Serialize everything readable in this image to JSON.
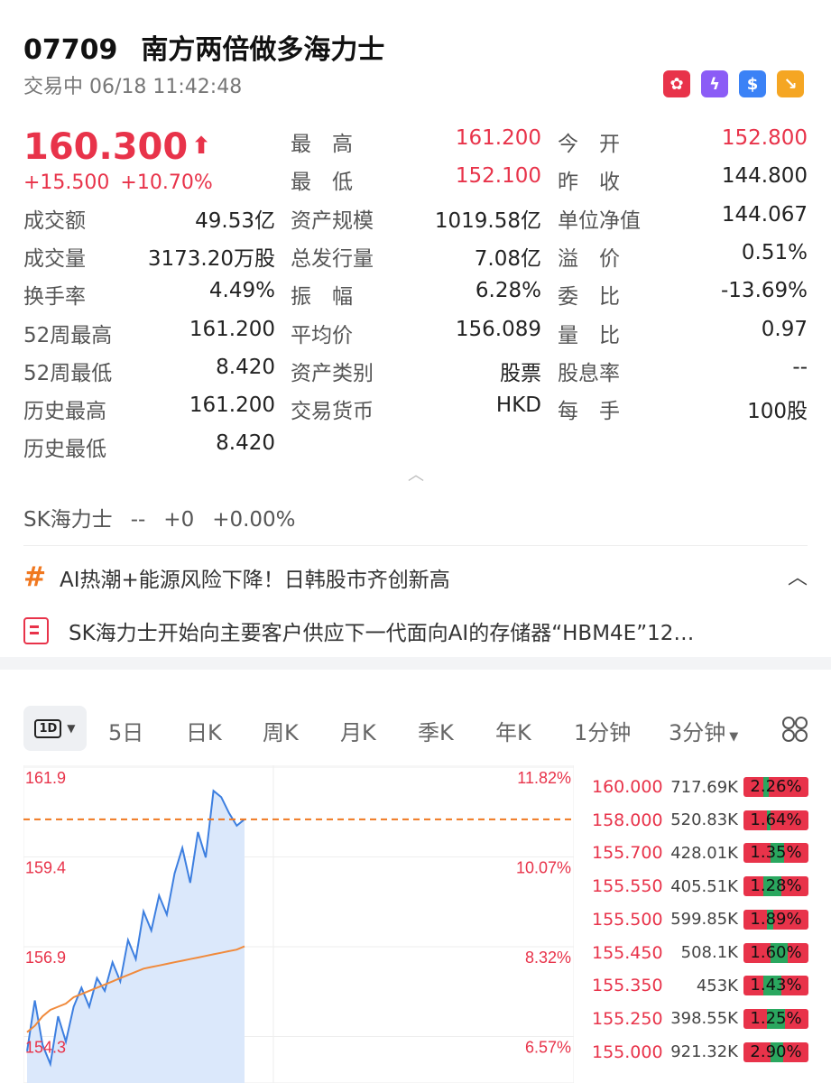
{
  "header": {
    "code": "07709",
    "name": "南方两倍做多海力士",
    "status": "交易中 06/18 11:42:48",
    "badges": [
      "hk-flag-icon",
      "lightning-icon",
      "dollar-icon",
      "trend-icon"
    ],
    "badge_colors": [
      "#e8334a",
      "#8b5cf6",
      "#3b82f6",
      "#f5a623"
    ]
  },
  "quote": {
    "price": "160.300",
    "change": "+15.500",
    "change_pct": "+10.70%",
    "colors": {
      "up": "#e8334a",
      "down": "#2aa75f"
    }
  },
  "stats": {
    "col1": [
      {
        "label": "成交额",
        "value": "49.53亿"
      },
      {
        "label": "成交量",
        "value": "3173.20万股"
      },
      {
        "label": "换手率",
        "value": "4.49%"
      },
      {
        "label": "52周最高",
        "value": "161.200"
      },
      {
        "label": "52周最低",
        "value": "8.420"
      },
      {
        "label": "历史最高",
        "value": "161.200"
      },
      {
        "label": "历史最低",
        "value": "8.420"
      }
    ],
    "col2": [
      {
        "label": "最　高",
        "value": "161.200"
      },
      {
        "label": "最　低",
        "value": "152.100"
      },
      {
        "label": "资产规模",
        "value": "1019.58亿"
      },
      {
        "label": "总发行量",
        "value": "7.08亿"
      },
      {
        "label": "振　幅",
        "value": "6.28%"
      },
      {
        "label": "平均价",
        "value": "156.089"
      },
      {
        "label": "资产类别",
        "value": "股票"
      },
      {
        "label": "交易货币",
        "value": "HKD"
      }
    ],
    "col3": [
      {
        "label": "今　开",
        "value": "152.800"
      },
      {
        "label": "昨　收",
        "value": "144.800"
      },
      {
        "label": "单位净值",
        "value": "144.067"
      },
      {
        "label": "溢　价",
        "value": "0.51%"
      },
      {
        "label": "委　比",
        "value": "-13.69%"
      },
      {
        "label": "量　比",
        "value": "0.97"
      },
      {
        "label": "股息率",
        "value": "--"
      },
      {
        "label": "每　手",
        "value": "100股"
      }
    ]
  },
  "underlying": {
    "name": "SK海力士",
    "price": "--",
    "change": "+0",
    "pct": "+0.00%"
  },
  "news": {
    "topic": "AI热潮+能源风险下降！日韩股市齐创新高",
    "headline": "SK海力士开始向主要客户供应下一代面向AI的存储器“HBM4E”12…"
  },
  "tabs": {
    "active": "1D",
    "items": [
      "5日",
      "日K",
      "周K",
      "月K",
      "季K",
      "年K",
      "1分钟",
      "3分钟"
    ]
  },
  "chart_data": {
    "type": "line",
    "y_left_ticks": [
      "161.9",
      "159.4",
      "156.9",
      "154.3"
    ],
    "y_right_ticks": [
      "11.82%",
      "10.07%",
      "8.32%",
      "6.57%"
    ],
    "ylim": [
      152.0,
      162.0
    ],
    "reference_price": 160.3,
    "series": [
      {
        "values": [
          153.0,
          154.6,
          153.2,
          152.6,
          154.1,
          153.3,
          154.4,
          155.0,
          154.4,
          155.3,
          154.9,
          155.8,
          155.2,
          156.5,
          155.9,
          157.4,
          156.8,
          157.9,
          157.3,
          158.6,
          159.4,
          158.3,
          159.9,
          159.1,
          161.2,
          161.0,
          160.5,
          160.1,
          160.3
        ]
      },
      {
        "values": [
          153.6,
          153.8,
          154.1,
          154.3,
          154.4,
          154.5,
          154.7,
          154.8,
          154.9,
          155.0,
          155.1,
          155.2,
          155.3,
          155.4,
          155.5,
          155.6,
          155.65,
          155.7,
          155.75,
          155.8,
          155.85,
          155.9,
          155.95,
          156.0,
          156.05,
          156.1,
          156.15,
          156.2,
          156.3
        ]
      }
    ]
  },
  "orderbook": [
    {
      "price": "160.000",
      "volume": "717.69K",
      "pct": "2.26%",
      "green": 0.25
    },
    {
      "price": "158.000",
      "volume": "520.83K",
      "pct": "1.64%",
      "green": 0.15
    },
    {
      "price": "155.700",
      "volume": "428.01K",
      "pct": "1.35%",
      "green": 0.6
    },
    {
      "price": "155.550",
      "volume": "405.51K",
      "pct": "1.28%",
      "green": 0.82
    },
    {
      "price": "155.500",
      "volume": "599.85K",
      "pct": "1.89%",
      "green": 0.3
    },
    {
      "price": "155.450",
      "volume": "508.1K",
      "pct": "1.60%",
      "green": 0.75
    },
    {
      "price": "155.350",
      "volume": "453K",
      "pct": "1.43%",
      "green": 0.8
    },
    {
      "price": "155.250",
      "volume": "398.55K",
      "pct": "1.25%",
      "green": 0.78
    },
    {
      "price": "155.000",
      "volume": "921.32K",
      "pct": "2.90%",
      "green": 0.55
    }
  ]
}
